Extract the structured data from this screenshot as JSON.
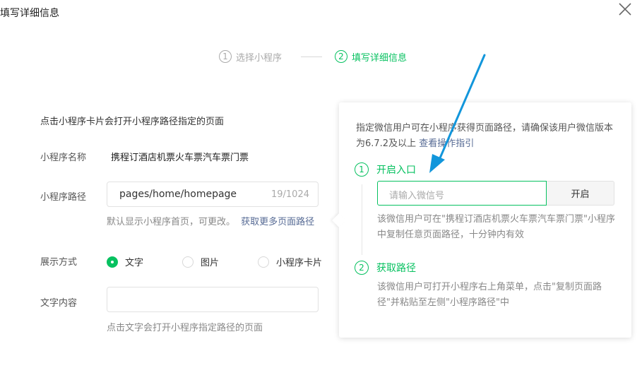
{
  "dialog": {
    "title": "填写详细信息",
    "close_icon": "close-icon"
  },
  "steps": [
    {
      "num": "1",
      "label": "选择小程序",
      "state": "done"
    },
    {
      "num": "2",
      "label": "填写详细信息",
      "state": "active"
    }
  ],
  "form": {
    "description": "点击小程序卡片会打开小程序路径指定的页面",
    "name_label": "小程序名称",
    "name_value": "携程订酒店机票火车票汽车票门票",
    "path_label": "小程序路径",
    "path_value": "pages/home/homepage",
    "path_count": "19/1024",
    "path_hint": "默认显示小程序首页，可更改。",
    "path_link": "获取更多页面路径",
    "display_label": "展示方式",
    "display_options": [
      "文字",
      "图片",
      "小程序卡片"
    ],
    "display_selected": "文字",
    "text_label": "文字内容",
    "text_value": "",
    "text_hint": "点击文字会打开小程序指定路径的页面"
  },
  "popover": {
    "desc_before": "指定微信用户可在小程序获得页面路径，请确保该用户微信版本为6.7.2及以上 ",
    "desc_link": "查看操作指引",
    "step1_num": "1",
    "step1_title": "开启入口",
    "wechat_placeholder": "请输入微信号",
    "enable_button": "开启",
    "step1_hint": "该微信用户可在\"携程订酒店机票火车票汽车票门票\"小程序中复制任意页面路径，十分钟内有效",
    "step2_num": "2",
    "step2_title": "获取路径",
    "step2_hint": "该微信用户可打开小程序右上角菜单，点击\"复制页面路径\"并粘贴至左侧\"小程序路径\"中"
  },
  "colors": {
    "accent": "#07c160",
    "link": "#576b95",
    "annotation_arrow": "#1296db"
  }
}
